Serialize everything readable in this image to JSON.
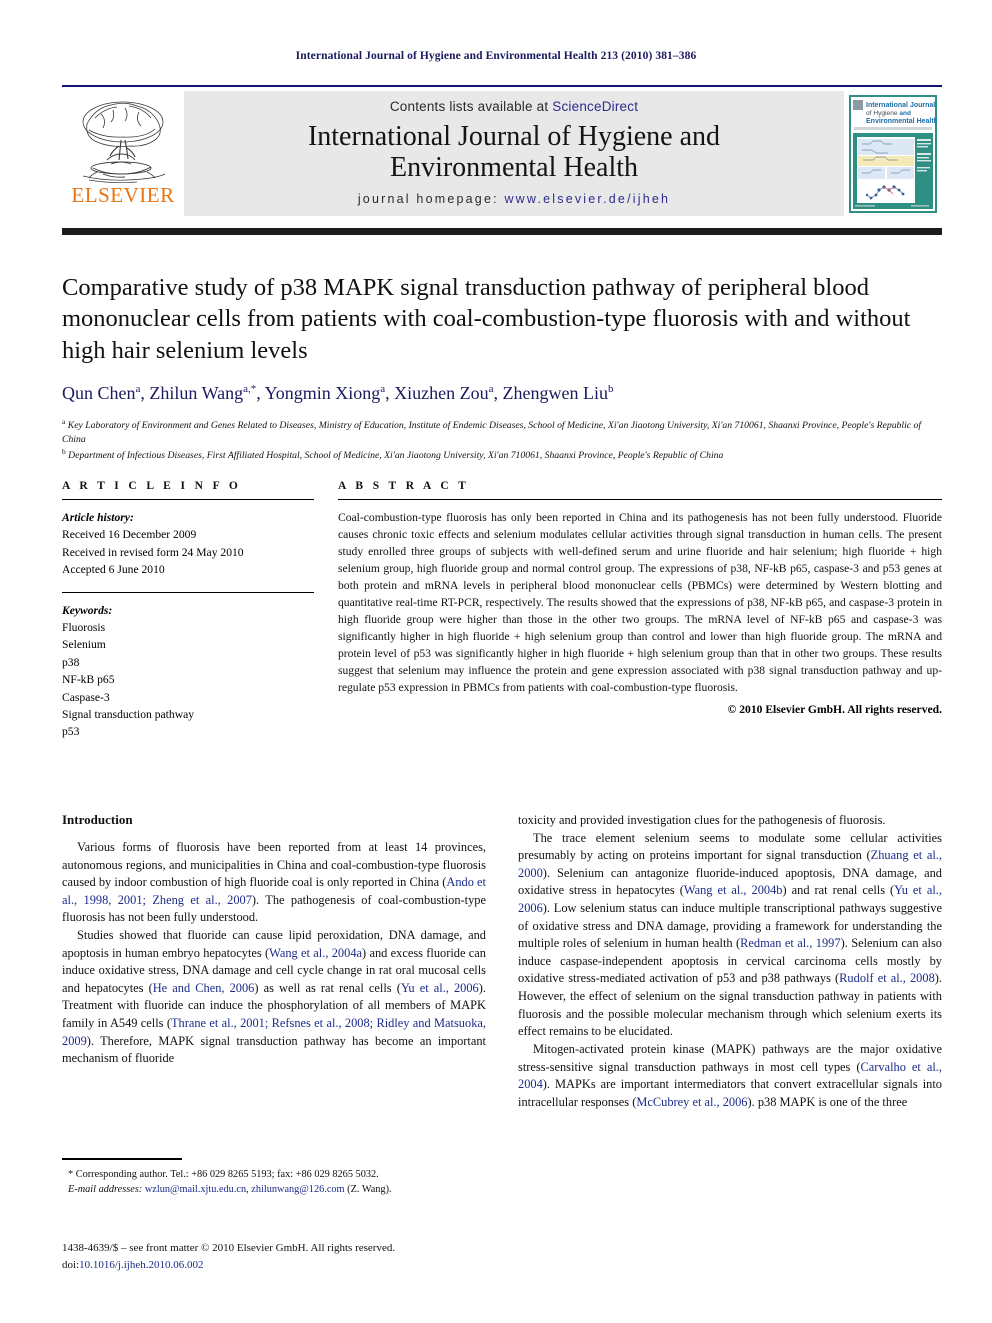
{
  "running_head": "International Journal of Hygiene and Environmental Health 213 (2010) 381–386",
  "masthead": {
    "publisher_name": "ELSEVIER",
    "contents_prefix": "Contents lists available at ",
    "contents_link": "ScienceDirect",
    "journal_title_line1": "International Journal of Hygiene and",
    "journal_title_line2": "Environmental Health",
    "homepage_prefix": "journal homepage: ",
    "homepage_url": "www.elsevier.de/ijheh",
    "cover": {
      "title_line1": "International Journal",
      "title_line2": "of Hygiene and",
      "title_line3": "Environmental Health"
    }
  },
  "article": {
    "title": "Comparative study of p38 MAPK signal transduction pathway of peripheral blood mononuclear cells from patients with coal-combustion-type fluorosis with and without high hair selenium levels",
    "authors_html": "Qun Chen<sup>a</sup>, Zhilun Wang<sup>a,*</sup>, Yongmin Xiong<sup>a</sup>, Xiuzhen Zou<sup>a</sup>, Zhengwen Liu<sup>b</sup>",
    "affiliation_a": "Key Laboratory of Environment and Genes Related to Diseases, Ministry of Education, Institute of Endemic Diseases, School of Medicine, Xi'an Jiaotong University, Xi'an 710061, Shaanxi Province, People's Republic of China",
    "affiliation_b": "Department of Infectious Diseases, First Affiliated Hospital, School of Medicine, Xi'an Jiaotong University, Xi'an 710061, Shaanxi Province, People's Republic of China"
  },
  "article_info": {
    "heading": "A R T I C L E   I N F O",
    "history_label": "Article history:",
    "history": [
      "Received 16 December 2009",
      "Received in revised form 24 May 2010",
      "Accepted 6 June 2010"
    ],
    "keywords_label": "Keywords:",
    "keywords": [
      "Fluorosis",
      "Selenium",
      "p38",
      "NF-kB p65",
      "Caspase-3",
      "Signal transduction pathway",
      "p53"
    ]
  },
  "abstract": {
    "heading": "A B S T R A C T",
    "text": "Coal-combustion-type fluorosis has only been reported in China and its pathogenesis has not been fully understood. Fluoride causes chronic toxic effects and selenium modulates cellular activities through signal transduction in human cells. The present study enrolled three groups of subjects with well-defined serum and urine fluoride and hair selenium; high fluoride + high selenium group, high fluoride group and normal control group. The expressions of p38, NF-kB p65, caspase-3 and p53 genes at both protein and mRNA levels in peripheral blood mononuclear cells (PBMCs) were determined by Western blotting and quantitative real-time RT-PCR, respectively. The results showed that the expressions of p38, NF-kB p65, and caspase-3 protein in high fluoride group were higher than those in the other two groups. The mRNA level of NF-kB p65 and caspase-3 was significantly higher in high fluoride + high selenium group than control and lower than high fluoride group. The mRNA and protein level of p53 was significantly higher in high fluoride + high selenium group than that in other two groups. These results suggest that selenium may influence the protein and gene expression associated with p38 signal transduction pathway and up-regulate p53 expression in PBMCs from patients with coal-combustion-type fluorosis.",
    "copyright": "© 2010 Elsevier GmbH. All rights reserved."
  },
  "body": {
    "intro_heading": "Introduction",
    "left_paragraphs": [
      "Various forms of fluorosis have been reported from at least 14 provinces, autonomous regions, and municipalities in China and coal-combustion-type fluorosis caused by indoor combustion of high fluoride coal is only reported in China (<span class=\"cite\">Ando et al., 1998, 2001; Zheng et al., 2007</span>). The pathogenesis of coal-combustion-type fluorosis has not been fully understood.",
      "Studies showed that fluoride can cause lipid peroxidation, DNA damage, and apoptosis in human embryo hepatocytes (<span class=\"cite\">Wang et al., 2004a</span>) and excess fluoride can induce oxidative stress, DNA damage and cell cycle change in rat oral mucosal cells and hepatocytes (<span class=\"cite\">He and Chen, 2006</span>) as well as rat renal cells (<span class=\"cite\">Yu et al., 2006</span>). Treatment with fluoride can induce the phosphorylation of all members of MAPK family in A549 cells (<span class=\"cite\">Thrane et al., 2001; Refsnes et al., 2008; Ridley and Matsuoka, 2009</span>). Therefore, MAPK signal transduction pathway has become an important mechanism of fluoride"
    ],
    "right_paragraphs": [
      "toxicity and provided investigation clues for the pathogenesis of fluorosis.",
      "The trace element selenium seems to modulate some cellular activities presumably by acting on proteins important for signal transduction (<span class=\"cite\">Zhuang et al., 2000</span>). Selenium can antagonize fluoride-induced apoptosis, DNA damage, and oxidative stress in hepatocytes (<span class=\"cite\">Wang et al., 2004b</span>) and rat renal cells (<span class=\"cite\">Yu et al., 2006</span>). Low selenium status can induce multiple transcriptional pathways suggestive of oxidative stress and DNA damage, providing a framework for understanding the multiple roles of selenium in human health (<span class=\"cite\">Redman et al., 1997</span>). Selenium can also induce caspase-independent apoptosis in cervical carcinoma cells mostly by oxidative stress-mediated activation of p53 and p38 pathways (<span class=\"cite\">Rudolf et al., 2008</span>). However, the effect of selenium on the signal transduction pathway in patients with fluorosis and the possible molecular mechanism through which selenium exerts its effect remains to be elucidated.",
      "Mitogen-activated protein kinase (MAPK) pathways are the major oxidative stress-sensitive signal transduction pathways in most cell types (<span class=\"cite\">Carvalho et al., 2004</span>). MAPKs are important intermediators that convert extracellular signals into intracellular responses (<span class=\"cite\">McCubrey et al., 2006</span>). p38 MAPK is one of the three"
    ]
  },
  "footnotes": {
    "corresponding": "* Corresponding author. Tel.: +86 029 8265 5193; fax: +86 029 8265 5032.",
    "email_label": "E-mail addresses:",
    "email_1": "wzlun@mail.xjtu.edu.cn",
    "email_2": "zhilunwang@126.com",
    "email_suffix": "(Z. Wang).",
    "front_matter": "1438-4639/$ – see front matter © 2010 Elsevier GmbH. All rights reserved.",
    "doi_label": "doi:",
    "doi_value": "10.1016/j.ijheh.2010.06.002"
  },
  "colors": {
    "elsevier_orange": "#E87511",
    "link_blue": "#2c2c8c",
    "navy": "#1a1a5e",
    "masthead_gray": "#e8e8e8",
    "cover_teal": "#2e8f83"
  }
}
